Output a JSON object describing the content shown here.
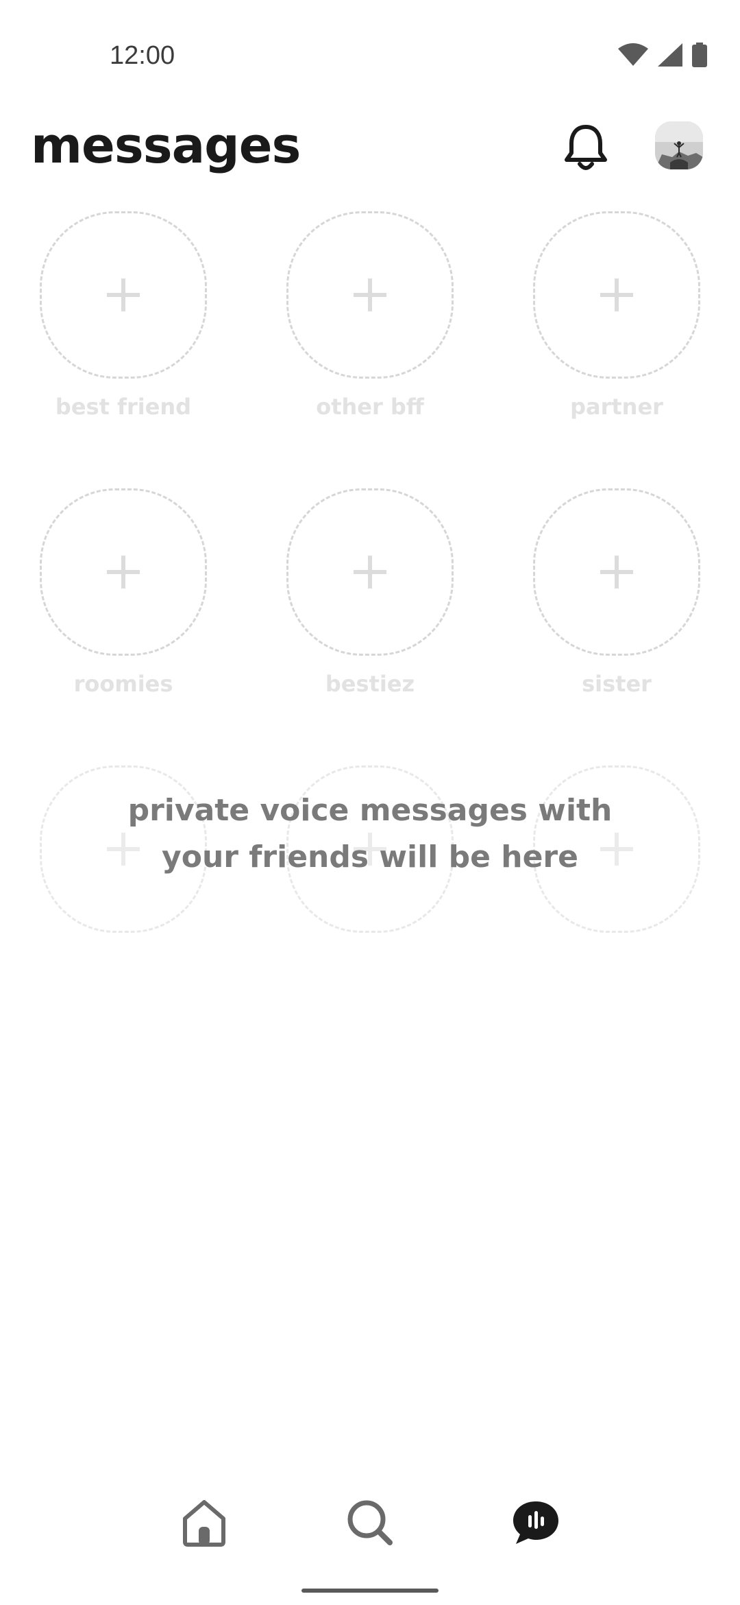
{
  "status_bar": {
    "time": "12:00",
    "icons": [
      "wifi-icon",
      "signal-icon",
      "battery-icon"
    ]
  },
  "header": {
    "title": "messages",
    "bell_icon": "bell-icon",
    "avatar": "profile-avatar"
  },
  "slots": [
    {
      "label": "best friend",
      "icon": "plus-icon"
    },
    {
      "label": "other bff",
      "icon": "plus-icon"
    },
    {
      "label": "partner",
      "icon": "plus-icon"
    },
    {
      "label": "roomies",
      "icon": "plus-icon"
    },
    {
      "label": "bestiez",
      "icon": "plus-icon"
    },
    {
      "label": "sister",
      "icon": "plus-icon"
    },
    {
      "label": "",
      "icon": "plus-icon"
    },
    {
      "label": "",
      "icon": "plus-icon"
    },
    {
      "label": "",
      "icon": "plus-icon"
    }
  ],
  "empty_state": {
    "line1": "private voice messages with",
    "line2": "your friends will be here"
  },
  "bottom_nav": {
    "items": [
      {
        "icon": "home-icon"
      },
      {
        "icon": "search-icon"
      },
      {
        "icon": "voice-messages-icon",
        "active": true
      }
    ]
  },
  "colors": {
    "title": "#1a1a1a",
    "placeholder_border": "#d6d6d6",
    "placeholder_label": "#e2e2e2",
    "empty_text": "#7a7a7a",
    "active_nav": "#1a1a1a"
  }
}
